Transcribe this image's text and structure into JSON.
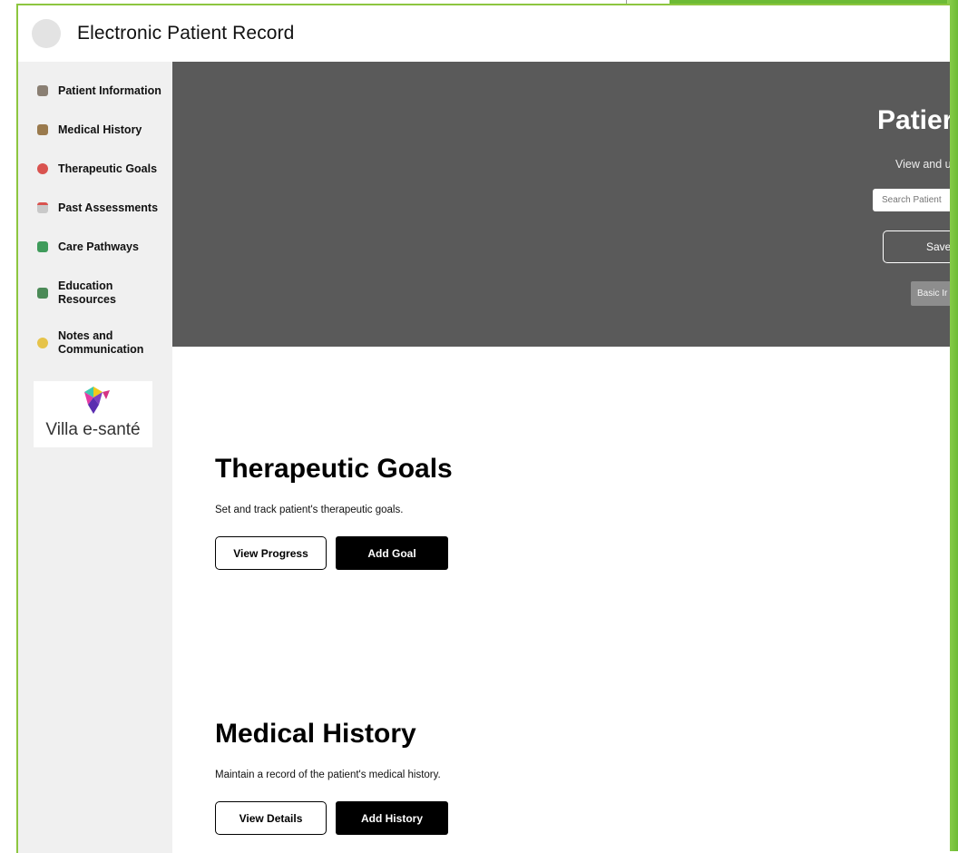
{
  "header": {
    "title": "Electronic Patient Record"
  },
  "sidebar": {
    "items": [
      {
        "label": "Patient Information",
        "icon": "hospital-icon"
      },
      {
        "label": "Medical History",
        "icon": "scroll-icon"
      },
      {
        "label": "Therapeutic Goals",
        "icon": "target-icon"
      },
      {
        "label": "Past Assessments",
        "icon": "calendar-icon"
      },
      {
        "label": "Care Pathways",
        "icon": "ambulance-icon"
      },
      {
        "label": "Education Resources",
        "icon": "books-icon"
      },
      {
        "label": "Notes and Communication",
        "icon": "pen-icon"
      }
    ],
    "logo_text": "Villa e-santé"
  },
  "hero": {
    "title": "Patier",
    "subtitle": "View and u",
    "search_placeholder": "Search Patient",
    "save_label": "Save",
    "basic_label": "Basic Ir"
  },
  "sections": [
    {
      "title": "Therapeutic Goals",
      "description": "Set and track patient's therapeutic goals.",
      "secondary_button": "View Progress",
      "primary_button": "Add Goal"
    },
    {
      "title": "Medical History",
      "description": "Maintain a record of the patient's medical history.",
      "secondary_button": "View Details",
      "primary_button": "Add History"
    }
  ],
  "colors": {
    "frame_green": "#8dc63f",
    "hero_bg": "#5a5a5a",
    "sidebar_bg": "#f0f0f0",
    "primary_button": "#000000"
  }
}
